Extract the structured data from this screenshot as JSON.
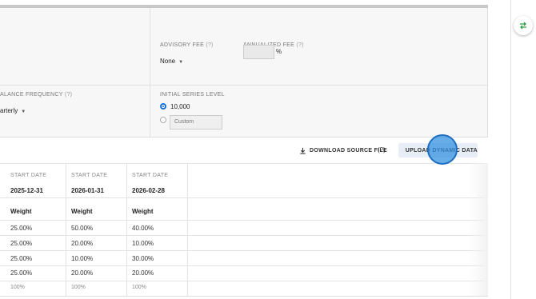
{
  "settings": {
    "advisory_fee_label": "ADVISORY FEE",
    "advisory_fee_help": "(?)",
    "advisory_fee_value": "None",
    "annualized_fee_label": "ANNUALIZED FEE",
    "annualized_fee_help": "(?)",
    "annualized_fee_unit": "%",
    "rebalance_label": "ALANCE FREQUENCY",
    "rebalance_help": "(?)",
    "rebalance_value": "arterly",
    "initial_level_label": "INITIAL SERIES LEVEL",
    "initial_level_option_1": "10,000",
    "initial_level_option_2_placeholder": "Custom"
  },
  "toolbar": {
    "download_label": "DOWNLOAD SOURCE FILE",
    "download_help": "(?)",
    "upload_label": "UPLOAD DYNAMIC DATA"
  },
  "table": {
    "header_label": "START DATE",
    "dates": [
      "2025-12-31",
      "2026-01-31",
      "2026-02-28"
    ],
    "weight_label": "Weight",
    "rows": [
      [
        "25.00%",
        "50.00%",
        "40.00%"
      ],
      [
        "25.00%",
        "20.00%",
        "10.00%"
      ],
      [
        "25.00%",
        "10.00%",
        "30.00%"
      ],
      [
        "25.00%",
        "20.00%",
        "20.00%"
      ]
    ],
    "totals": [
      "100%",
      "100%",
      "100%"
    ]
  }
}
